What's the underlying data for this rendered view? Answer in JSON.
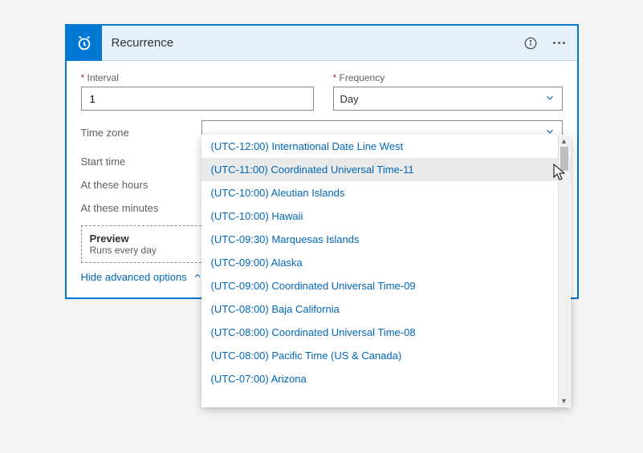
{
  "header": {
    "title": "Recurrence"
  },
  "fields": {
    "interval": {
      "label": "Interval",
      "value": "1"
    },
    "frequency": {
      "label": "Frequency",
      "value": "Day"
    },
    "timezone": {
      "label": "Time zone",
      "value": ""
    },
    "start_time": {
      "label": "Start time"
    },
    "at_hours": {
      "label": "At these hours"
    },
    "at_minutes": {
      "label": "At these minutes"
    }
  },
  "preview": {
    "title": "Preview",
    "subtitle": "Runs every day"
  },
  "advanced_link": "Hide advanced options",
  "timezone_options": [
    "(UTC-12:00) International Date Line West",
    "(UTC-11:00) Coordinated Universal Time-11",
    "(UTC-10:00) Aleutian Islands",
    "(UTC-10:00) Hawaii",
    "(UTC-09:30) Marquesas Islands",
    "(UTC-09:00) Alaska",
    "(UTC-09:00) Coordinated Universal Time-09",
    "(UTC-08:00) Baja California",
    "(UTC-08:00) Coordinated Universal Time-08",
    "(UTC-08:00) Pacific Time (US & Canada)",
    "(UTC-07:00) Arizona"
  ],
  "hovered_option_index": 1
}
